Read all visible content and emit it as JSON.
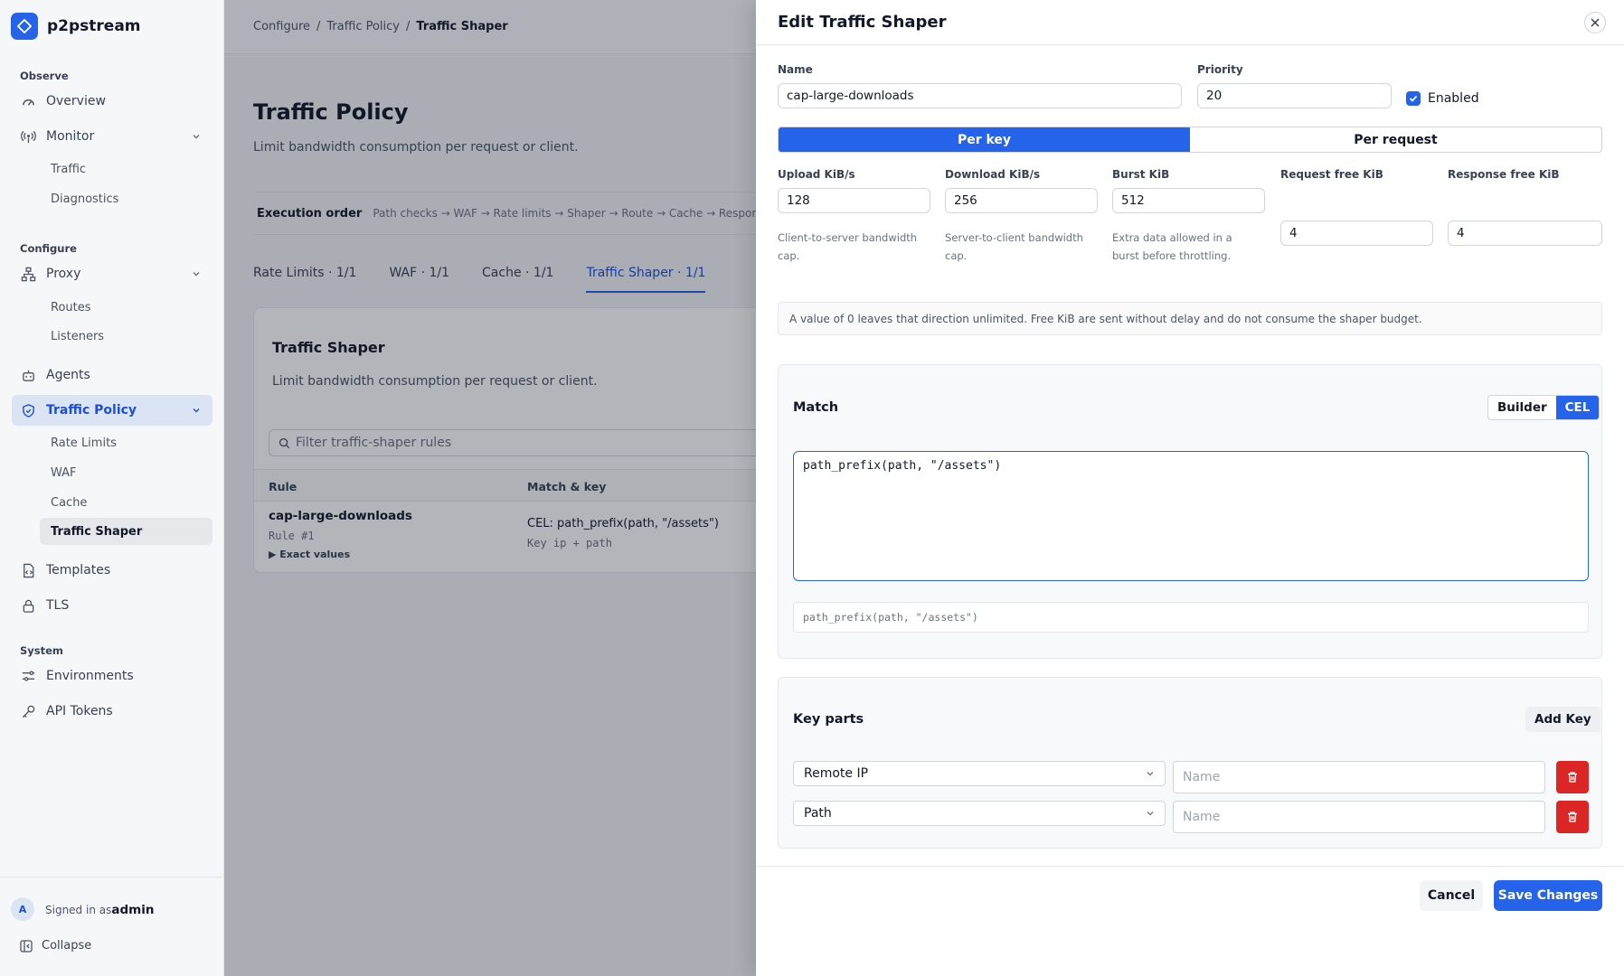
{
  "app": {
    "name": "p2pstream"
  },
  "sidebar": {
    "sections": {
      "observe": "Observe",
      "configure": "Configure",
      "system": "System"
    },
    "items": {
      "overview": "Overview",
      "monitor": "Monitor",
      "traffic": "Traffic",
      "diagnostics": "Diagnostics",
      "proxy": "Proxy",
      "routes": "Routes",
      "listeners": "Listeners",
      "agents": "Agents",
      "traffic_policy": "Traffic Policy",
      "rate_limits": "Rate Limits",
      "waf": "WAF",
      "cache": "Cache",
      "traffic_shaper": "Traffic Shaper",
      "templates": "Templates",
      "tls": "TLS",
      "environments": "Environments",
      "api_tokens": "API Tokens"
    },
    "footer": {
      "avatar_letter": "A",
      "signed_in_prefix": "Signed in as",
      "user": "admin",
      "collapse": "Collapse"
    }
  },
  "breadcrumb": {
    "l1": "Configure",
    "sep": "/",
    "l2": "Traffic Policy",
    "l3": "Traffic Shaper"
  },
  "page": {
    "title": "Traffic Policy",
    "subtitle": "Limit bandwidth consumption per request or client.",
    "exec_label": "Execution order",
    "exec_sequence": "Path checks → WAF → Rate limits → Shaper → Route → Cache → Response",
    "tabs": [
      "Rate Limits · 1/1",
      "WAF · 1/1",
      "Cache · 1/1",
      "Traffic Shaper · 1/1"
    ],
    "active_tab": 3,
    "card": {
      "title": "Traffic Shaper",
      "subtitle": "Limit bandwidth consumption per request or client.",
      "filter_placeholder": "Filter traffic-shaper rules",
      "col_rule": "Rule",
      "col_match": "Match & key",
      "row": {
        "name": "cap-large-downloads",
        "number": "Rule #1",
        "exact": "▶ Exact values",
        "match": "CEL: path_prefix(path, \"/assets\")",
        "key": "Key ip + path"
      }
    }
  },
  "drawer": {
    "title": "Edit Traffic Shaper",
    "name_label": "Name",
    "name_value": "cap-large-downloads",
    "priority_label": "Priority",
    "priority_value": "20",
    "enabled_label": "Enabled",
    "enabled": true,
    "mode_per_key": "Per key",
    "mode_per_request": "Per request",
    "mode_selected": "Per key",
    "upload_label": "Upload KiB/s",
    "upload_value": "128",
    "upload_help": "Client-to-server bandwidth cap.",
    "download_label": "Download KiB/s",
    "download_value": "256",
    "download_help": "Server-to-client bandwidth cap.",
    "burst_label": "Burst KiB",
    "burst_value": "512",
    "burst_help": "Extra data allowed in a burst before throttling.",
    "req_free_label": "Request free KiB",
    "req_free_value": "4",
    "resp_free_label": "Response free KiB",
    "resp_free_value": "4",
    "note": "A value of 0 leaves that direction unlimited. Free KiB are sent without delay and do not consume the shaper budget.",
    "match": {
      "title": "Match",
      "builder": "Builder",
      "cel": "CEL",
      "mode_selected": "CEL",
      "expression": "path_prefix(path, \"/assets\")",
      "preview": "path_prefix(path, \"/assets\")"
    },
    "keys": {
      "title": "Key parts",
      "add_label": "Add Key",
      "rows": [
        {
          "type": "Remote IP",
          "name_placeholder": "Name"
        },
        {
          "type": "Path",
          "name_placeholder": "Name"
        }
      ]
    },
    "cancel": "Cancel",
    "save": "Save Changes"
  },
  "colors": {
    "accent": "#2563eb",
    "danger": "#dc2626"
  }
}
